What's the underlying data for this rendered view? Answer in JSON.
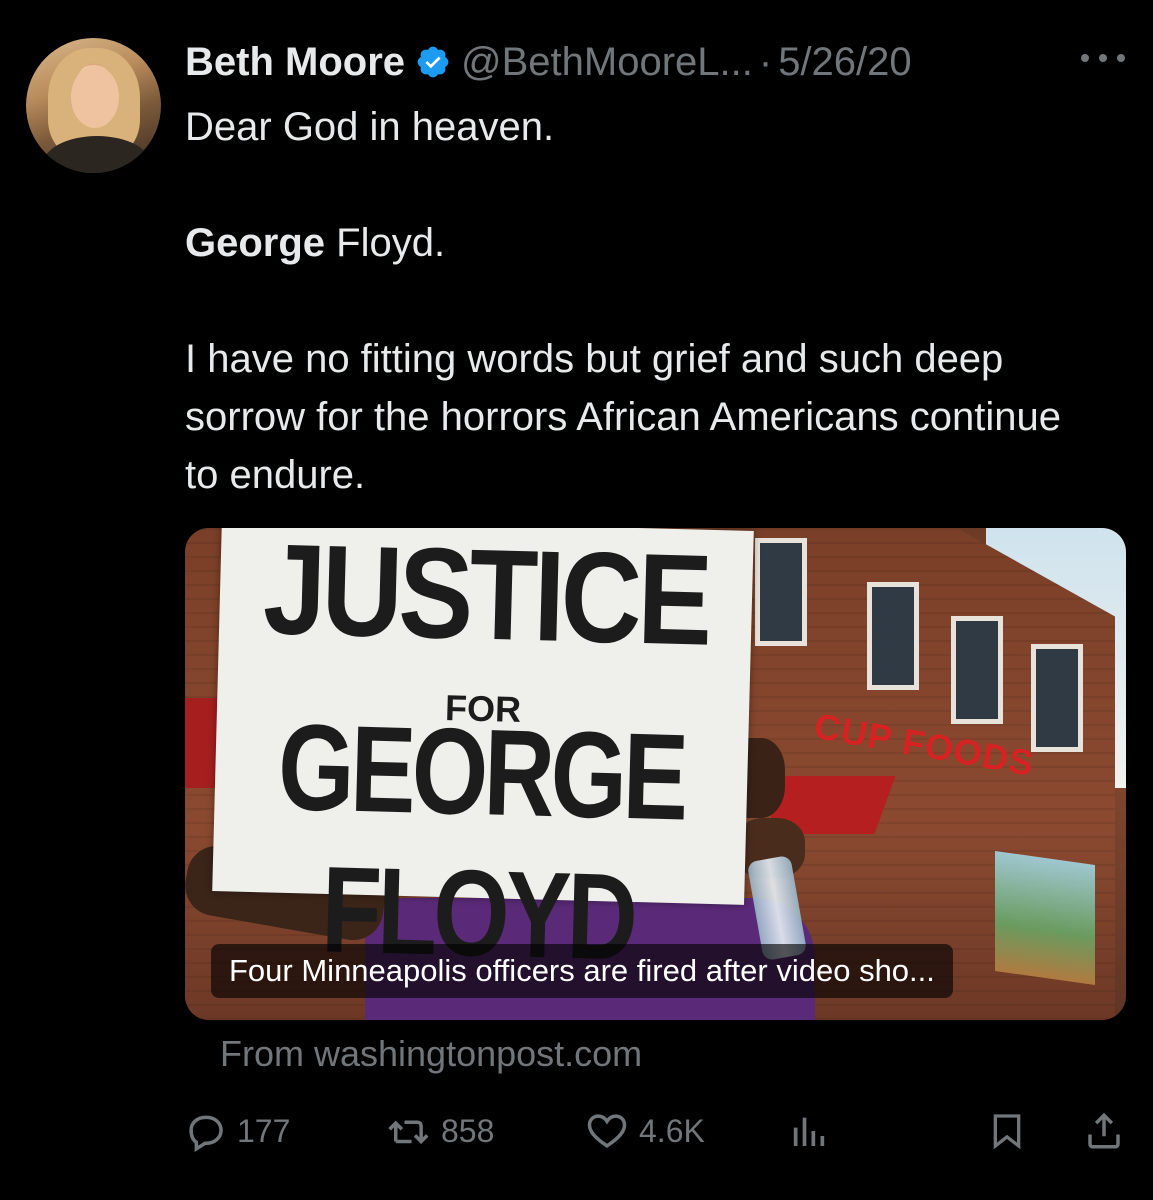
{
  "tweet": {
    "author_name": "Beth Moore",
    "handle": "@BethMooreL...",
    "separator": "·",
    "date": "5/26/20",
    "text_line1": "Dear God in heaven.",
    "text_line2_bold": "George",
    "text_line2_rest": " Floyd.",
    "text_line3": "I have no fitting words but grief and such deep sorrow for the horrors African Americans continue to endure."
  },
  "card": {
    "image_sign_line1": "JUSTICE",
    "image_sign_line2": "FOR",
    "image_sign_line3": "GEORGE FLOYD",
    "store_sign": "CUP FOODS",
    "caption": "Four Minneapolis officers are fired after video sho...",
    "source": "From washingtonpost.com"
  },
  "actions": {
    "replies": "177",
    "retweets": "858",
    "likes": "4.6K"
  },
  "icons": [
    "verified-badge-icon",
    "more-icon",
    "reply-icon",
    "retweet-icon",
    "like-icon",
    "views-icon",
    "bookmark-icon",
    "share-icon"
  ],
  "colors": {
    "background": "#000000",
    "text": "#e7e9ea",
    "muted": "#71767b",
    "verified": "#1d9bf0"
  }
}
